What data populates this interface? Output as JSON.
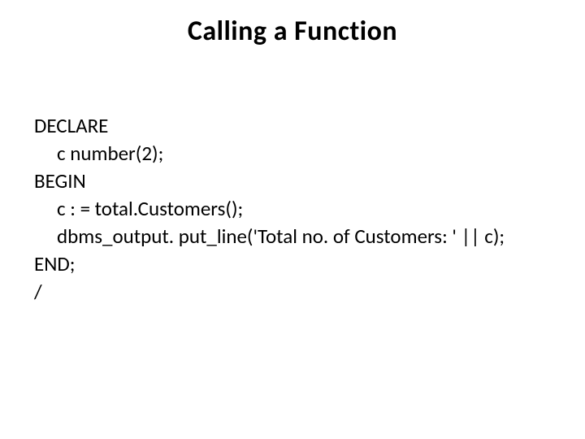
{
  "slide": {
    "title": "Calling a Function",
    "code": {
      "l1": "DECLARE",
      "l2": "c number(2);",
      "l3": "BEGIN",
      "l4": "c : = total.Customers();",
      "l5": "dbms_output. put_line('Total no. of Customers: ' || c);",
      "l6": "END;",
      "l7": "/"
    }
  }
}
